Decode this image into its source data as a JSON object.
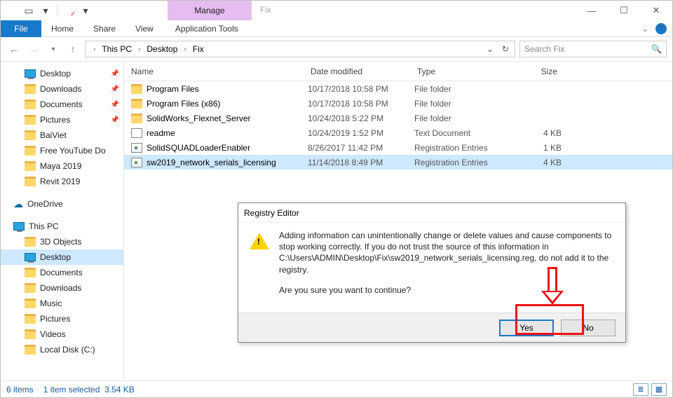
{
  "window": {
    "context_tab": "Manage",
    "header_label": "Fix"
  },
  "ribbon": {
    "file": "File",
    "tabs": [
      "Home",
      "Share",
      "View"
    ],
    "tools": "Application Tools"
  },
  "breadcrumb": [
    "This PC",
    "Desktop",
    "Fix"
  ],
  "search": {
    "placeholder": "Search Fix"
  },
  "tree": {
    "quick": [
      {
        "label": "Desktop",
        "pin": true,
        "icon": "monitor"
      },
      {
        "label": "Downloads",
        "pin": true,
        "icon": "folder"
      },
      {
        "label": "Documents",
        "pin": true,
        "icon": "folder"
      },
      {
        "label": "Pictures",
        "pin": true,
        "icon": "folder"
      },
      {
        "label": "BaiViet",
        "pin": false,
        "icon": "folder"
      },
      {
        "label": "Free YouTube Do",
        "pin": false,
        "icon": "folder"
      },
      {
        "label": "Maya 2019",
        "pin": false,
        "icon": "folder"
      },
      {
        "label": "Revit 2019",
        "pin": false,
        "icon": "folder"
      }
    ],
    "onedrive": "OneDrive",
    "thispc": "This PC",
    "pc_children": [
      "3D Objects",
      "Desktop",
      "Documents",
      "Downloads",
      "Music",
      "Pictures",
      "Videos",
      "Local Disk (C:)"
    ]
  },
  "columns": {
    "name": "Name",
    "date": "Date modified",
    "type": "Type",
    "size": "Size"
  },
  "files": [
    {
      "name": "Program Files",
      "date": "10/17/2018 10:58 PM",
      "type": "File folder",
      "size": "",
      "icon": "folder"
    },
    {
      "name": "Program Files (x86)",
      "date": "10/17/2018 10:58 PM",
      "type": "File folder",
      "size": "",
      "icon": "folder"
    },
    {
      "name": "SolidWorks_Flexnet_Server",
      "date": "10/24/2018 5:22 PM",
      "type": "File folder",
      "size": "",
      "icon": "folder"
    },
    {
      "name": "readme",
      "date": "10/24/2019 1:52 PM",
      "type": "Text Document",
      "size": "4 KB",
      "icon": "txt"
    },
    {
      "name": "SolidSQUADLoaderEnabler",
      "date": "8/26/2017 11:42 PM",
      "type": "Registration Entries",
      "size": "1 KB",
      "icon": "reg"
    },
    {
      "name": "sw2019_network_serials_licensing",
      "date": "11/14/2018 8:49 PM",
      "type": "Registration Entries",
      "size": "4 KB",
      "icon": "reg",
      "selected": true
    }
  ],
  "status": {
    "count": "6 items",
    "selection": "1 item selected",
    "size": "3.54 KB"
  },
  "dialog": {
    "title": "Registry Editor",
    "body1": "Adding information can unintentionally change or delete values and cause components to stop working correctly. If you do not trust the source of this information in C:\\Users\\ADMIN\\Desktop\\Fix\\sw2019_network_serials_licensing.reg, do not add it to the registry.",
    "body2": "Are you sure you want to continue?",
    "yes": "Yes",
    "no": "No"
  }
}
